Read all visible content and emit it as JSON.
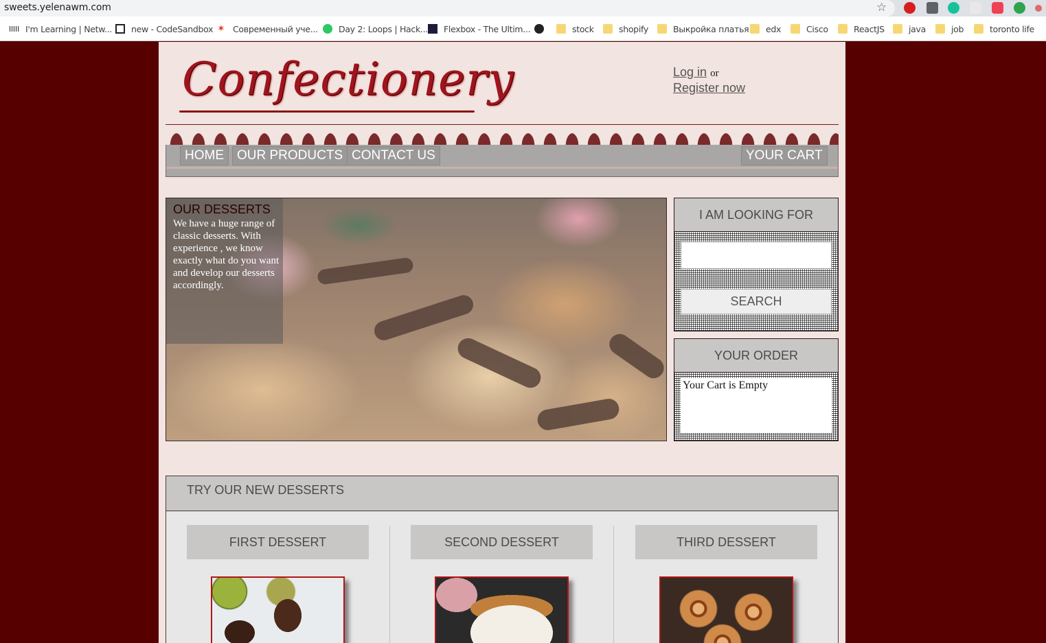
{
  "browser": {
    "url": "sweets.yelenawm.com",
    "bookmarks": [
      {
        "label": "I'm Learning | Netw..."
      },
      {
        "label": "new - CodeSandbox"
      },
      {
        "label": "Современный уче..."
      },
      {
        "label": "Day 2: Loops | Hack..."
      },
      {
        "label": "Flexbox - The Ultim..."
      },
      {
        "label": ""
      },
      {
        "label": "stock"
      },
      {
        "label": "shopify"
      },
      {
        "label": "Выкройка платья"
      },
      {
        "label": "edx"
      },
      {
        "label": "Cisco"
      },
      {
        "label": "ReactJS"
      },
      {
        "label": "java"
      },
      {
        "label": "job"
      },
      {
        "label": "toronto life"
      }
    ]
  },
  "site": {
    "logo": "Confectionery",
    "login": "Log in",
    "or": "or",
    "register": "Register now",
    "nav": {
      "home": "HOME",
      "products": "OUR PRODUCTS",
      "contact": "CONTACT US",
      "cart": "YOUR CART"
    },
    "hero": {
      "title": "OUR DESSERTS",
      "text": "We have a huge range of classic desserts. With experience , we know exactly what do you want and develop our desserts accordingly."
    },
    "search_panel": {
      "title": "I AM LOOKING FOR",
      "button": "SEARCH",
      "value": ""
    },
    "order_panel": {
      "title": "YOUR ORDER",
      "empty": "Your Cart is Empty"
    },
    "new_desserts": {
      "title": "TRY OUR NEW DESSERTS",
      "items": [
        {
          "title": "FIRST DESSERT"
        },
        {
          "title": "SECOND DESSERT"
        },
        {
          "title": "THIRD DESSERT"
        }
      ]
    }
  },
  "colors": {
    "background": "#570000",
    "page": "#f2e4e0",
    "accent": "#a0141e"
  }
}
